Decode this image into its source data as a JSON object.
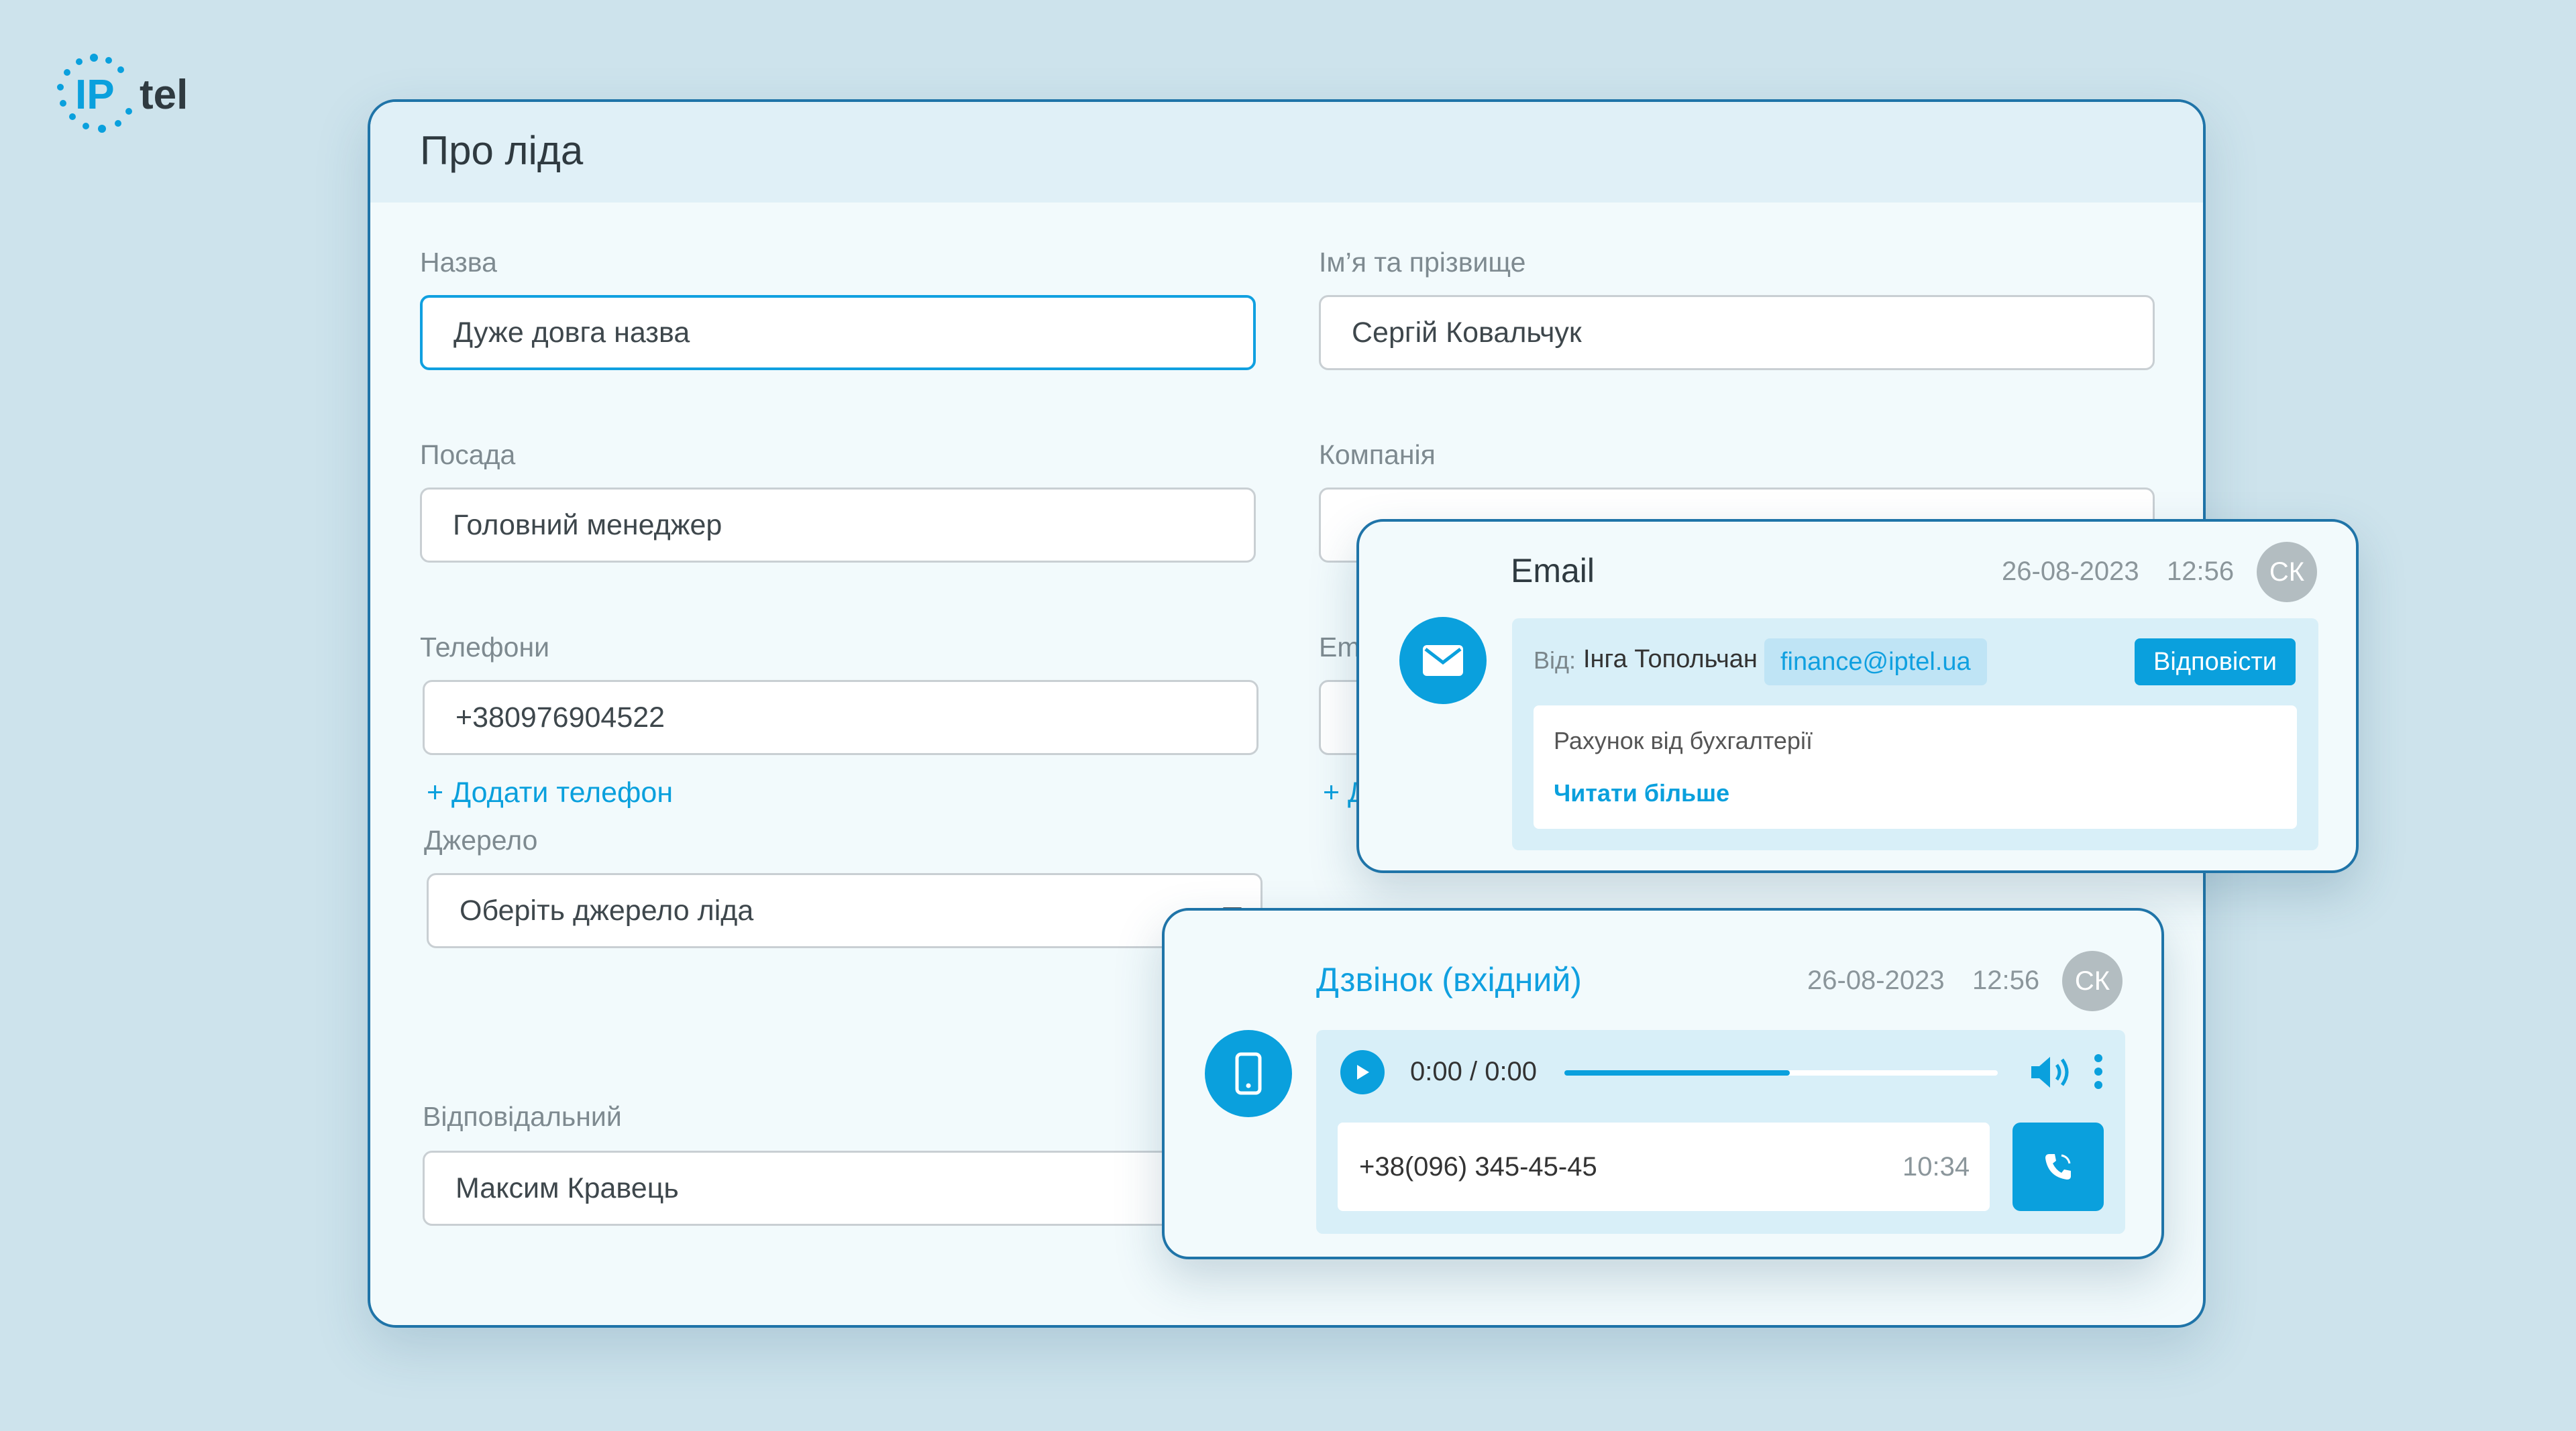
{
  "brand": {
    "logo_text_1": "IP",
    "logo_text_2": "tel",
    "accent": "#0aa0dd",
    "border": "#1f74a8"
  },
  "lead": {
    "title": "Про ліда",
    "name_label": "Назва",
    "name_value": "Дуже довга назва",
    "fullname_label": "Ім’я та прізвище",
    "fullname_value": "Сергій Ковальчук",
    "position_label": "Посада",
    "position_value": "Головний менеджер",
    "company_label": "Компанія",
    "company_value": "",
    "phones_label": "Телефони",
    "phone_value": "+380976904522",
    "add_phone": "+ Додати телефон",
    "email_label_partial": "Em",
    "add_email_partial": "+ Д",
    "source_label": "Джерело",
    "source_placeholder": "Оберіть джерело ліда",
    "responsible_label": "Відповідальний",
    "responsible_value": "Максим Кравець"
  },
  "email_event": {
    "icon": "envelope-icon",
    "title": "Email",
    "date": "26-08-2023",
    "time": "12:56",
    "avatar": "СК",
    "from_label": "Від:",
    "from_name": "Інга Топольчан",
    "from_email": "finance@iptel.ua",
    "reply": "Відповісти",
    "subject": "Рахунок від бухгалтерії",
    "read_more": "Читати більше"
  },
  "call_event": {
    "icon": "mobile-phone-icon",
    "title": "Дзвінок (вхідний)",
    "date": "26-08-2023",
    "time": "12:56",
    "avatar": "СК",
    "player_time": "0:00 / 0:00",
    "progress": 0.52,
    "phone": "+38(096) 345-45-45",
    "call_time": "10:34"
  }
}
